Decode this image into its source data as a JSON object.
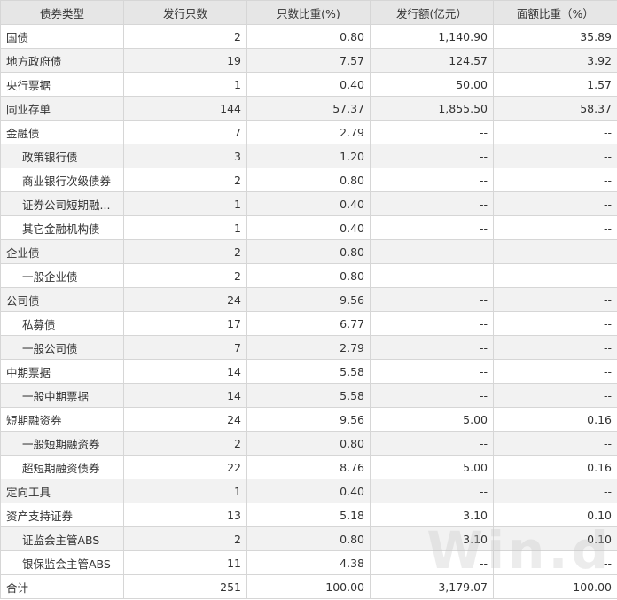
{
  "table": {
    "headers": [
      "债券类型",
      "发行只数",
      "只数比重(%)",
      "发行额(亿元）",
      "面额比重（%）"
    ],
    "rows": [
      {
        "name": "国债",
        "sub": false,
        "count": "2",
        "count_pct": "0.80",
        "amount": "1,140.90",
        "amount_pct": "35.89"
      },
      {
        "name": "地方政府债",
        "sub": false,
        "count": "19",
        "count_pct": "7.57",
        "amount": "124.57",
        "amount_pct": "3.92"
      },
      {
        "name": "央行票据",
        "sub": false,
        "count": "1",
        "count_pct": "0.40",
        "amount": "50.00",
        "amount_pct": "1.57"
      },
      {
        "name": "同业存单",
        "sub": false,
        "count": "144",
        "count_pct": "57.37",
        "amount": "1,855.50",
        "amount_pct": "58.37"
      },
      {
        "name": "金融债",
        "sub": false,
        "count": "7",
        "count_pct": "2.79",
        "amount": "--",
        "amount_pct": "--"
      },
      {
        "name": "政策银行债",
        "sub": true,
        "count": "3",
        "count_pct": "1.20",
        "amount": "--",
        "amount_pct": "--"
      },
      {
        "name": "商业银行次级债券",
        "sub": true,
        "count": "2",
        "count_pct": "0.80",
        "amount": "--",
        "amount_pct": "--"
      },
      {
        "name": "证券公司短期融...",
        "sub": true,
        "count": "1",
        "count_pct": "0.40",
        "amount": "--",
        "amount_pct": "--"
      },
      {
        "name": "其它金融机构债",
        "sub": true,
        "count": "1",
        "count_pct": "0.40",
        "amount": "--",
        "amount_pct": "--"
      },
      {
        "name": "企业债",
        "sub": false,
        "count": "2",
        "count_pct": "0.80",
        "amount": "--",
        "amount_pct": "--"
      },
      {
        "name": "一般企业债",
        "sub": true,
        "count": "2",
        "count_pct": "0.80",
        "amount": "--",
        "amount_pct": "--"
      },
      {
        "name": "公司债",
        "sub": false,
        "count": "24",
        "count_pct": "9.56",
        "amount": "--",
        "amount_pct": "--"
      },
      {
        "name": "私募债",
        "sub": true,
        "count": "17",
        "count_pct": "6.77",
        "amount": "--",
        "amount_pct": "--"
      },
      {
        "name": "一般公司债",
        "sub": true,
        "count": "7",
        "count_pct": "2.79",
        "amount": "--",
        "amount_pct": "--"
      },
      {
        "name": "中期票据",
        "sub": false,
        "count": "14",
        "count_pct": "5.58",
        "amount": "--",
        "amount_pct": "--"
      },
      {
        "name": "一般中期票据",
        "sub": true,
        "count": "14",
        "count_pct": "5.58",
        "amount": "--",
        "amount_pct": "--"
      },
      {
        "name": "短期融资券",
        "sub": false,
        "count": "24",
        "count_pct": "9.56",
        "amount": "5.00",
        "amount_pct": "0.16"
      },
      {
        "name": "一般短期融资券",
        "sub": true,
        "count": "2",
        "count_pct": "0.80",
        "amount": "--",
        "amount_pct": "--"
      },
      {
        "name": "超短期融资债券",
        "sub": true,
        "count": "22",
        "count_pct": "8.76",
        "amount": "5.00",
        "amount_pct": "0.16"
      },
      {
        "name": "定向工具",
        "sub": false,
        "count": "1",
        "count_pct": "0.40",
        "amount": "--",
        "amount_pct": "--"
      },
      {
        "name": "资产支持证券",
        "sub": false,
        "count": "13",
        "count_pct": "5.18",
        "amount": "3.10",
        "amount_pct": "0.10"
      },
      {
        "name": "证监会主管ABS",
        "sub": true,
        "count": "2",
        "count_pct": "0.80",
        "amount": "3.10",
        "amount_pct": "0.10"
      },
      {
        "name": "银保监会主管ABS",
        "sub": true,
        "count": "11",
        "count_pct": "4.38",
        "amount": "--",
        "amount_pct": "--"
      },
      {
        "name": "合计",
        "sub": false,
        "count": "251",
        "count_pct": "100.00",
        "amount": "3,179.07",
        "amount_pct": "100.00"
      }
    ]
  },
  "watermark": "Win.d",
  "colors": {
    "header_bg": "#e6e6e6",
    "alt_row_bg": "#f2f2f2",
    "border": "#d6d6d6"
  }
}
